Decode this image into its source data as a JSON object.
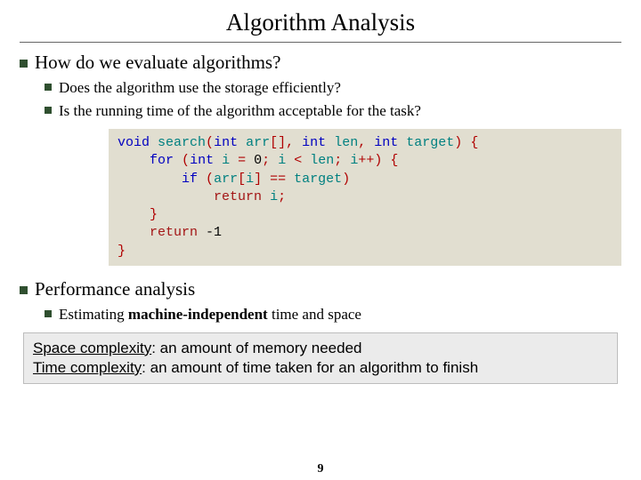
{
  "title": "Algorithm Analysis",
  "q1": "How do we evaluate algorithms?",
  "q1a": "Does the algorithm use the storage efficiently?",
  "q1b": "Is the running time of the algorithm acceptable for the task?",
  "code": {
    "kw_void": "void",
    "fn_search": "search",
    "kw_int1": "int",
    "id_arr": "arr",
    "brk": "[]",
    "comma1": ",",
    "kw_int2": "int",
    "id_len": "len",
    "comma2": ",",
    "kw_int3": "int",
    "id_target": "target",
    "paren_open": "(",
    "paren_close": ")",
    "brace_open": "{",
    "kw_for": "for",
    "kw_int4": "int",
    "id_i": "i",
    "eq": "=",
    "zero": "0",
    "semi": ";",
    "lt": "<",
    "incr": "++)",
    "kw_if": "if",
    "eqeq": "==",
    "kw_return1": "return",
    "kw_return2": "return",
    "neg1": "-1",
    "brace_close": "}"
  },
  "perf_heading": "Performance analysis",
  "perf_sub_pre": "Estimating ",
  "perf_sub_bold": "machine-independent",
  "perf_sub_post": " time and space",
  "callout": {
    "space_label": "Space complexity",
    "space_text": ": an amount of memory needed",
    "time_label": "Time complexity",
    "time_text": ": an amount of time taken for an algorithm to finish"
  },
  "page": "9"
}
